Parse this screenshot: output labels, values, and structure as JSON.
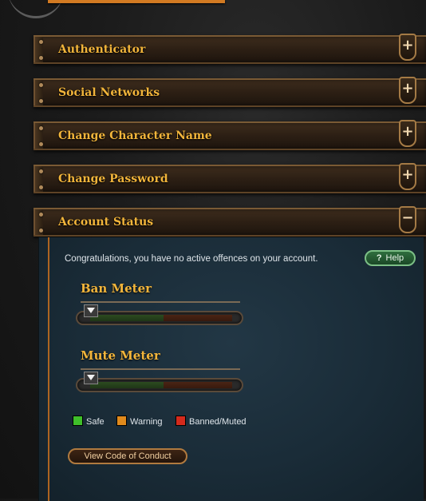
{
  "panels": [
    {
      "label": "Authenticator",
      "toggle": "+"
    },
    {
      "label": "Social Networks",
      "toggle": "+"
    },
    {
      "label": "Change Character Name",
      "toggle": "+"
    },
    {
      "label": "Change Password",
      "toggle": "+"
    },
    {
      "label": "Account Status",
      "toggle": "−"
    }
  ],
  "account_status": {
    "message": "Congratulations, you have no active offences on your account.",
    "help_label": "Help",
    "help_icon": "?",
    "ban_meter": {
      "title": "Ban Meter",
      "level": 0
    },
    "mute_meter": {
      "title": "Mute Meter",
      "level": 0
    },
    "legend": [
      {
        "label": "Safe",
        "color": "#3fbf2a"
      },
      {
        "label": "Warning",
        "color": "#e08a1c"
      },
      {
        "label": "Banned/Muted",
        "color": "#d42a1c"
      }
    ],
    "code_of_conduct_label": "View Code of Conduct"
  },
  "colors": {
    "accent": "#f2b53b",
    "divider": "#d27a22"
  }
}
